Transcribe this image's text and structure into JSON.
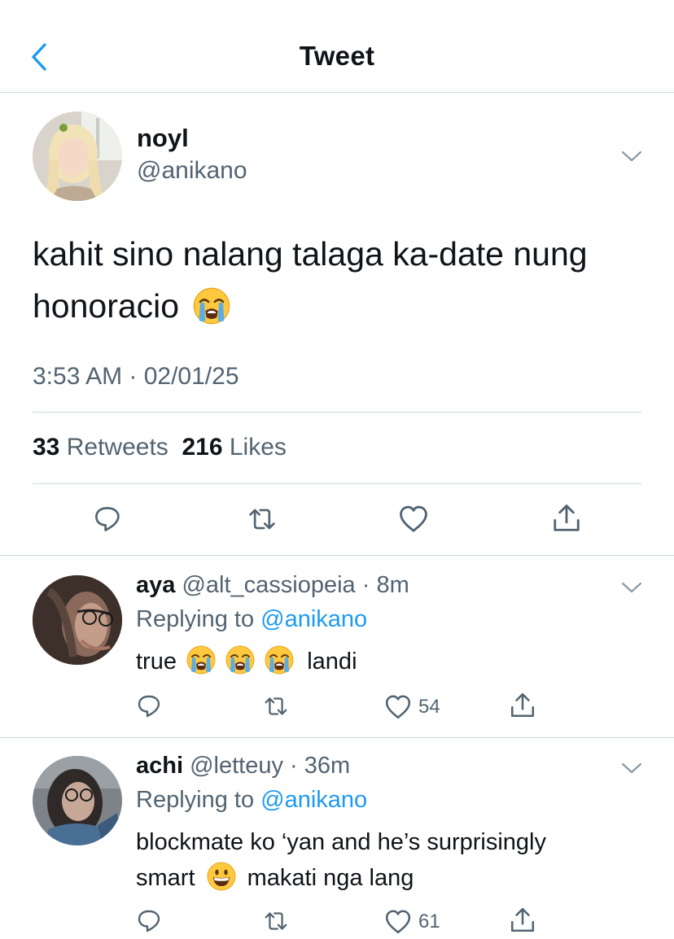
{
  "nav": {
    "title": "Tweet"
  },
  "tweet": {
    "name": "noyl",
    "handle": "@anikano",
    "text_line1": "kahit sino nalang talaga ka-date nung",
    "text_line2": "honoracio",
    "timestamp": "3:53 AM · 02/01/25",
    "retweets_count": "33",
    "retweets_label": "Retweets",
    "likes_count": "216",
    "likes_label": "Likes"
  },
  "replies": [
    {
      "name": "aya",
      "handle": "@alt_cassiopeia",
      "sep": "·",
      "time": "8m",
      "replying_prefix": "Replying to",
      "replying_to": "@anikano",
      "text_a": "true",
      "text_b": "landi",
      "likes": "54"
    },
    {
      "name": "achi",
      "handle": "@letteuy",
      "sep": "·",
      "time": "36m",
      "replying_prefix": "Replying to",
      "replying_to": "@anikano",
      "text_line1": "blockmate ko ‘yan and he’s surprisingly",
      "text_line2a": "smart",
      "text_line2b": "makati nga lang",
      "likes": "61"
    }
  ],
  "colors": {
    "accent": "#1d9bf0",
    "secondary_text": "#536471",
    "divider": "#cfd9de"
  },
  "icons": [
    "back-chevron-icon",
    "chevron-down-icon",
    "reply-icon",
    "retweet-icon",
    "like-icon",
    "share-icon",
    "loudly-crying-face-emoji",
    "grinning-face-emoji"
  ]
}
